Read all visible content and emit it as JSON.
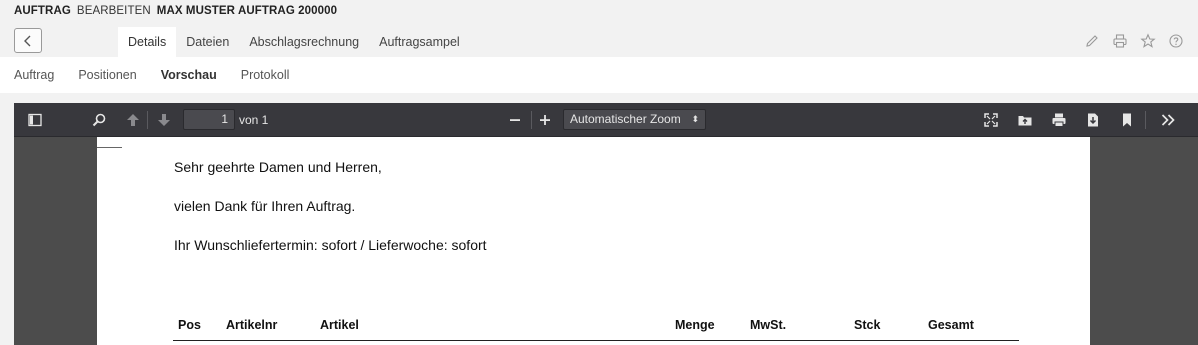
{
  "header": {
    "title_parts": [
      "AUFTRAG",
      "BEARBEITEN",
      "MAX MUSTER AUFTRAG 200000"
    ],
    "tabs": [
      {
        "label": "Details",
        "active": true
      },
      {
        "label": "Dateien",
        "active": false
      },
      {
        "label": "Abschlagsrechnung",
        "active": false
      },
      {
        "label": "Auftragsampel",
        "active": false
      }
    ],
    "icons": [
      "pencil-icon",
      "print-icon",
      "star-icon",
      "help-icon"
    ]
  },
  "subnav": {
    "items": [
      {
        "label": "Auftrag",
        "active": false
      },
      {
        "label": "Positionen",
        "active": false
      },
      {
        "label": "Vorschau",
        "active": true
      },
      {
        "label": "Protokoll",
        "active": false
      }
    ]
  },
  "pdf_viewer": {
    "page_number": "1",
    "page_count_label": "von 1",
    "zoom_label": "Automatischer Zoom",
    "document": {
      "lines": [
        "Sehr geehrte Damen und Herren,",
        "vielen Dank für Ihren Auftrag.",
        "Ihr Wunschliefertermin: sofort / Lieferwoche: sofort"
      ],
      "table_headers": [
        "Pos",
        "Artikelnr",
        "Artikel",
        "Menge",
        "MwSt.",
        "Stck",
        "Gesamt"
      ]
    }
  },
  "colors": {
    "toolbar_bg": "#38383d",
    "page_bg": "#ffffff",
    "header_bg": "#f2f2f2"
  }
}
